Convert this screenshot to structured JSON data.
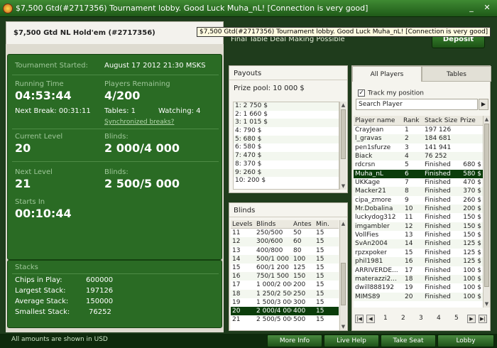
{
  "window": {
    "title": "$7,500 Gtd(#2717356) Tournament lobby. Good Luck Muha_nL!   [Connection is very good]",
    "minimize": "_",
    "close": "✕"
  },
  "tooltip": "$7,500 Gtd(#2717356) Tournament lobby. Good Luck Muha_nL!   [Connection is very good]",
  "header": {
    "title": "$7,500 Gtd NL Hold'em (#2717356)"
  },
  "deal_text": "Final Table Deal Making Possible",
  "deposit_label": "Deposit",
  "info": {
    "started_label": "Tournament Started:",
    "started_value": "August 17 2012  21:30 MSKS",
    "running_label": "Running Time",
    "running_value": "04:53:44",
    "remaining_label": "Players Remaining",
    "remaining_value": "4/200",
    "next_break": "Next Break: 00:31:11",
    "tables": "Tables: 1",
    "watching": "Watching: 4",
    "sync_link": "Synchronized breaks?",
    "current_level_label": "Current Level",
    "current_level_value": "20",
    "blinds_label": "Blinds:",
    "current_blinds": "2 000/4 000",
    "next_level_label": "Next Level",
    "next_level_value": "21",
    "next_blinds": "2 500/5 000",
    "starts_in_label": "Starts In",
    "starts_in_value": "00:10:44"
  },
  "stacks": {
    "title": "Stacks",
    "rows": [
      {
        "label": "Chips in Play:",
        "value": "600000"
      },
      {
        "label": "Largest Stack:",
        "value": "197126"
      },
      {
        "label": "Average Stack:",
        "value": "150000"
      },
      {
        "label": "Smallest Stack:",
        "value": "76252"
      }
    ]
  },
  "payouts": {
    "title": "Payouts",
    "prize_pool": "Prize pool: 10 000 $",
    "items": [
      "1: 2 750 $",
      "2: 1 660 $",
      "3: 1 015 $",
      "4: 790 $",
      "5: 680 $",
      "6: 580 $",
      "7: 470 $",
      "8: 370 $",
      "9: 260 $",
      "10: 200 $"
    ]
  },
  "blinds": {
    "title": "Blinds",
    "headers": [
      "Levels",
      "Blinds",
      "Antes",
      "Min."
    ],
    "rows": [
      [
        "11",
        "250/500",
        "50",
        "15"
      ],
      [
        "12",
        "300/600",
        "60",
        "15"
      ],
      [
        "13",
        "400/800",
        "80",
        "15"
      ],
      [
        "14",
        "500/1 000",
        "100",
        "15"
      ],
      [
        "15",
        "600/1 200",
        "125",
        "15"
      ],
      [
        "16",
        "750/1 500",
        "150",
        "15"
      ],
      [
        "17",
        "1 000/2 000",
        "200",
        "15"
      ],
      [
        "18",
        "1 250/2 500",
        "250",
        "15"
      ],
      [
        "19",
        "1 500/3 000",
        "300",
        "15"
      ],
      [
        "20",
        "2 000/4 000",
        "400",
        "15"
      ],
      [
        "21",
        "2 500/5 000",
        "500",
        "15"
      ]
    ],
    "highlight_level": "20"
  },
  "players": {
    "tabs": [
      "All Players",
      "Tables"
    ],
    "track_label": "Track my position",
    "search_placeholder": "Search Player",
    "headers": [
      "Player name",
      "Rank",
      "Stack Size",
      "Prize"
    ],
    "rows": [
      [
        "CrayJean",
        "1",
        "197 126",
        ""
      ],
      [
        "l_gravas",
        "2",
        "184 681",
        ""
      ],
      [
        "pen1sfurze",
        "3",
        "141 941",
        ""
      ],
      [
        "Biack",
        "4",
        "76 252",
        ""
      ],
      [
        "rdcrsn",
        "5",
        "Finished",
        "680 $"
      ],
      [
        "Muha_nL",
        "6",
        "Finished",
        "580 $"
      ],
      [
        "UKKage",
        "7",
        "Finished",
        "470 $"
      ],
      [
        "Macker21",
        "8",
        "Finished",
        "370 $"
      ],
      [
        "cipa_zmore",
        "9",
        "Finished",
        "260 $"
      ],
      [
        "Mr.Dobalina",
        "10",
        "Finished",
        "200 $"
      ],
      [
        "luckydog312",
        "11",
        "Finished",
        "150 $"
      ],
      [
        "imgambler",
        "12",
        "Finished",
        "150 $"
      ],
      [
        "VollFies",
        "13",
        "Finished",
        "150 $"
      ],
      [
        "SvAn2004",
        "14",
        "Finished",
        "125 $"
      ],
      [
        "rpzxpoker",
        "15",
        "Finished",
        "125 $"
      ],
      [
        "phil1981",
        "16",
        "Finished",
        "125 $"
      ],
      [
        "ARRIVERDE...",
        "17",
        "Finished",
        "100 $"
      ],
      [
        "materazzi2...",
        "18",
        "Finished",
        "100 $"
      ],
      [
        "dwill888192",
        "19",
        "Finished",
        "100 $"
      ],
      [
        "MIMS89",
        "20",
        "Finished",
        "100 $"
      ]
    ],
    "highlight_player": "Muha_nL",
    "pages": [
      "1",
      "2",
      "3",
      "4",
      "5"
    ]
  },
  "footer": {
    "note": "All amounts are shown in USD",
    "buttons": [
      "More Info",
      "Live Help",
      "Take Seat",
      "Lobby"
    ]
  },
  "colors": {
    "panel_green": "#2a6b24",
    "highlight_row": "#0b3d0b"
  }
}
